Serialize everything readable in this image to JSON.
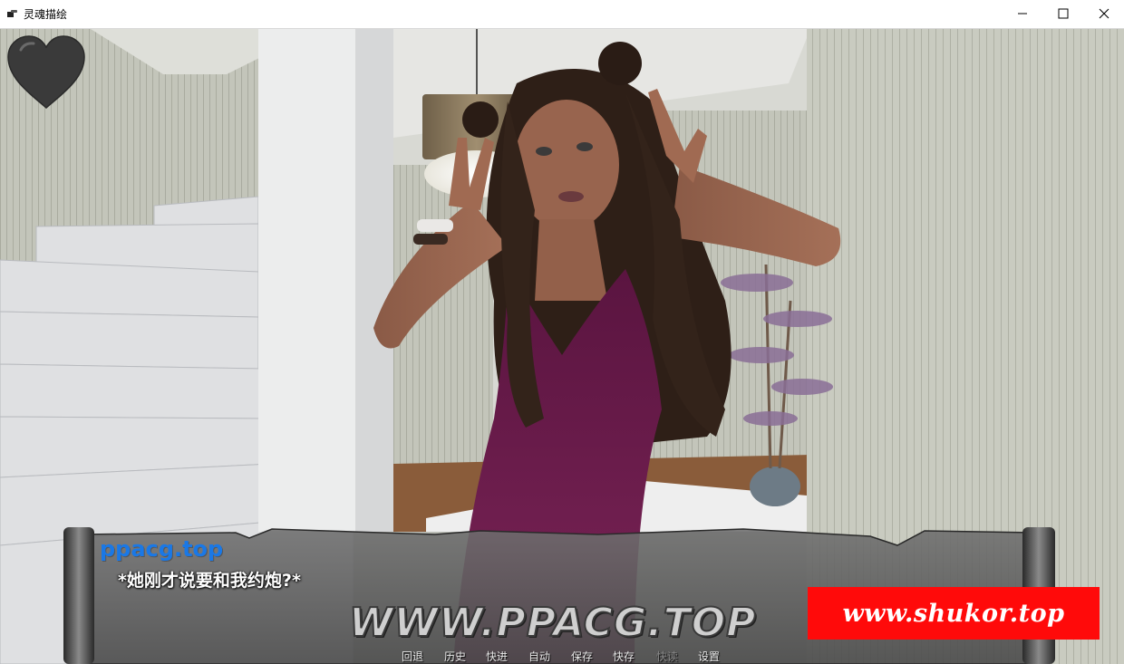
{
  "window": {
    "title": "灵魂描绘",
    "controls": [
      "minimize-icon",
      "maximize-icon",
      "close-icon"
    ]
  },
  "hud": {
    "heart_icon": "heart-icon",
    "heart_color": "#3a3a3a"
  },
  "dialogue": {
    "speaker": "ppacg.top",
    "text": "*她刚才说要和我约炮?*",
    "speaker_color": "#1a78e6"
  },
  "watermarks": {
    "site": "WWW.PPACG.TOP",
    "promo": "www.shukor.top",
    "promo_color": "#ff0a0a"
  },
  "quick_menu": {
    "items": [
      {
        "label": "回退",
        "enabled": true
      },
      {
        "label": "历史",
        "enabled": true
      },
      {
        "label": "快进",
        "enabled": true
      },
      {
        "label": "自动",
        "enabled": true
      },
      {
        "label": "保存",
        "enabled": true
      },
      {
        "label": "快存",
        "enabled": true
      },
      {
        "label": "快读",
        "enabled": false
      },
      {
        "label": "设置",
        "enabled": true
      }
    ]
  }
}
